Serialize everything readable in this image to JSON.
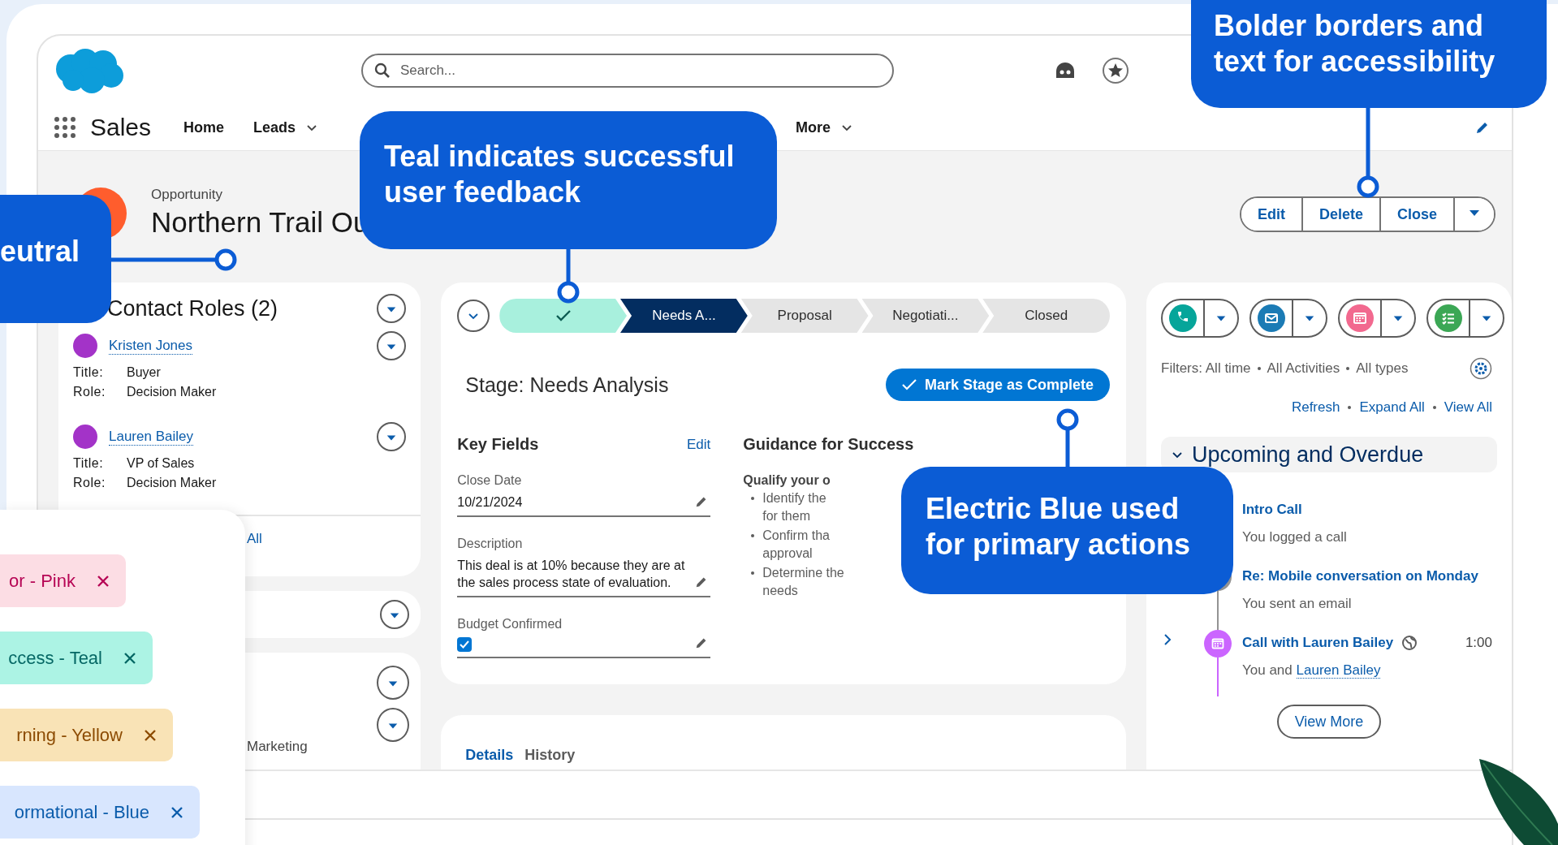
{
  "header": {
    "search": {
      "placeholder": "Search..."
    }
  },
  "nav": {
    "app_name": "Sales",
    "items": [
      {
        "label": "Home",
        "dropdown": false
      },
      {
        "label": "Leads",
        "dropdown": true
      }
    ],
    "more": {
      "label": "More",
      "dropdown": true
    }
  },
  "record": {
    "type_label": "Opportunity",
    "title": "Northern Trail Ou",
    "actions": [
      "Edit",
      "Delete",
      "Close"
    ]
  },
  "contact_roles": {
    "title": "Contact Roles (2)",
    "contacts": [
      {
        "name": "Kristen Jones",
        "fields": [
          {
            "label": "Title:",
            "value": "Buyer"
          },
          {
            "label": "Role:",
            "value": "Decision Maker"
          }
        ]
      },
      {
        "name": "Lauren Bailey",
        "fields": [
          {
            "label": "Title:",
            "value": "VP of Sales"
          },
          {
            "label": "Role:",
            "value": "Decision Maker"
          }
        ]
      }
    ],
    "footer_link": "All"
  },
  "related_card": {
    "text": "Marketing"
  },
  "path": {
    "steps": [
      {
        "complete": true,
        "selected": false
      },
      {
        "label": "Needs A...",
        "complete": false,
        "selected": true
      },
      {
        "label": "Proposal",
        "complete": false,
        "selected": false
      },
      {
        "label": "Negotiati...",
        "complete": false,
        "selected": false
      },
      {
        "label": "Closed",
        "complete": false,
        "selected": false
      }
    ]
  },
  "stage": {
    "title": "Stage: Needs Analysis",
    "button": "Mark Stage as Complete"
  },
  "key_fields": {
    "title": "Key Fields",
    "edit": "Edit",
    "fields": [
      {
        "kind": "text",
        "label": "Close Date",
        "value": "10/21/2024"
      },
      {
        "kind": "text",
        "label": "Description",
        "value": "This deal is at 10% because they are at the sales process state of evaluation."
      },
      {
        "kind": "checkbox",
        "label": "Budget Confirmed",
        "checked": true
      }
    ]
  },
  "guidance": {
    "title": "Guidance for Success",
    "heading": "Qualify your o",
    "bullets": [
      {
        "lines": [
          "Identify the",
          "for them"
        ]
      },
      {
        "lines": [
          "Confirm tha",
          "approval"
        ]
      },
      {
        "lines": [
          "Determine the",
          "needs"
        ]
      }
    ]
  },
  "tabs": [
    {
      "label": "Details",
      "selected": true
    },
    {
      "label": "History",
      "selected": false
    }
  ],
  "activity": {
    "actions": [
      {
        "kind": "call",
        "color": "#06a59a"
      },
      {
        "kind": "email",
        "color": "#1b7bb5"
      },
      {
        "kind": "event",
        "color": "#f2698f"
      },
      {
        "kind": "task",
        "color": "#3ba755"
      }
    ],
    "filters": [
      "Filters: All time",
      "All Activities",
      "All types"
    ],
    "links": [
      "Refresh",
      "Expand All",
      "View All"
    ],
    "section": {
      "title": "Upcoming and Overdue",
      "expanded": true
    },
    "items": [
      {
        "kind": "call",
        "title": "Intro Call",
        "subtitle": "You logged a call"
      },
      {
        "kind": "email",
        "title": "Re: Mobile conversation on Monday",
        "subtitle": "You sent an email"
      },
      {
        "kind": "event",
        "title": "Call with Lauren Bailey",
        "time": "1:00",
        "subtitle": "You and",
        "subtitle_link": "Lauren Bailey",
        "expanded": false
      }
    ],
    "view_more": "View More"
  },
  "callouts": [
    {
      "text": "eutral"
    },
    {
      "text": "Teal indicates successful user feedback"
    },
    {
      "text": "Bolder borders and text for accessibility"
    },
    {
      "text": "Electric Blue used for primary actions"
    }
  ],
  "tags": [
    {
      "label": "or - Pink",
      "color": "#fcdde4"
    },
    {
      "label": "ccess - Teal",
      "color": "#acf3e4"
    },
    {
      "label": "rning - Yellow",
      "color": "#f9e3b6"
    },
    {
      "label": "ormational - Blue",
      "color": "#d8e6fe"
    }
  ]
}
